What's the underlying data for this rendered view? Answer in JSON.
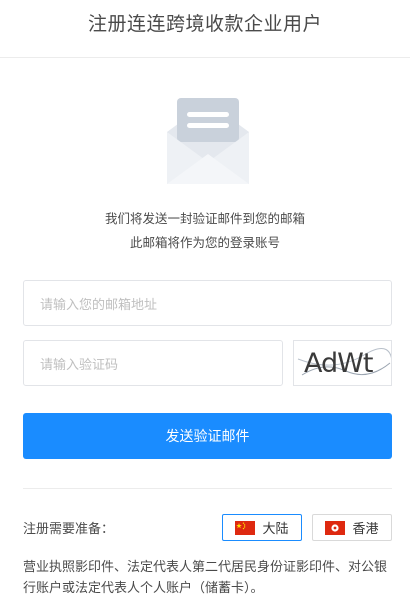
{
  "header": {
    "title": "注册连连跨境收款企业用户"
  },
  "icons": {
    "envelope": "envelope-icon",
    "flag_cn": "china-flag-icon",
    "flag_hk": "hong-kong-flag-icon"
  },
  "description": {
    "line1": "我们将发送一封验证邮件到您的邮箱",
    "line2": "此邮箱将作为您的登录账号"
  },
  "form": {
    "email_placeholder": "请输入您的邮箱地址",
    "code_placeholder": "请输入验证码",
    "captcha_text": "AdWt",
    "send_button": "发送验证邮件"
  },
  "registration": {
    "label": "注册需要准备：",
    "regions": [
      {
        "label": "大陆",
        "selected": true
      },
      {
        "label": "香港",
        "selected": false
      }
    ],
    "requirements": "营业执照影印件、法定代表人第二代居民身份证影印件、对公银行账户或法定代表人个人账户（储蓄卡）。"
  },
  "colors": {
    "primary": "#1a8cff",
    "border": "#e2e4e8",
    "text": "#4a4a4a"
  }
}
